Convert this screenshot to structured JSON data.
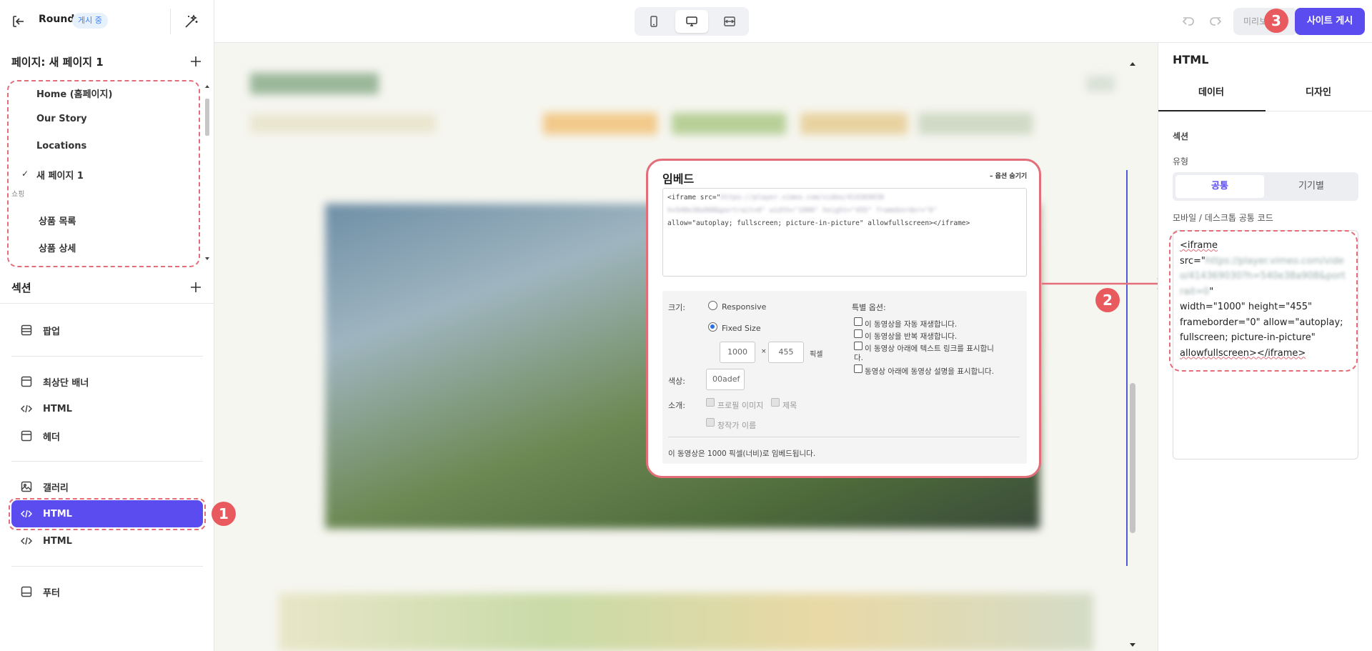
{
  "header": {
    "site_name": "Round",
    "status": "게시 중",
    "preview_label": "미리보기",
    "publish_label": "사이트 게시"
  },
  "pages": {
    "title": "페이지: 새 페이지 1",
    "items": [
      "Home (홈페이지)",
      "Our Story",
      "Locations",
      "새 페이지 1"
    ],
    "group_label": "쇼핑",
    "shop_items": [
      "상품 목록",
      "상품 상세"
    ]
  },
  "sections": {
    "title": "섹션",
    "items": [
      "팝업",
      "최상단 배너",
      "HTML",
      "헤더",
      "갤러리",
      "HTML",
      "HTML",
      "푸터"
    ]
  },
  "embed": {
    "title": "임베드",
    "hide_options": "– 옵션 숨기기",
    "code_line1_prefix": "<iframe src=\"",
    "code_line1_blur": "https://player.vimeo.com/video/414369030",
    "code_line2_blur": "h=540e38a908&portrait=0\" width=\"1000\" height=\"455\" frameborder=\"0\"",
    "code_line3": "allow=\"autoplay; fullscreen; picture-in-picture\" allowfullscreen></iframe>",
    "size_label": "크기:",
    "responsive_label": "Responsive",
    "fixed_label": "Fixed Size",
    "width": "1000",
    "times": "×",
    "height": "455",
    "pixel_label": "픽셀",
    "color_label": "색상:",
    "color_value": "00adef",
    "intro_label": "소개:",
    "profile_label": "프로필 이미지",
    "title_opt_label": "제목",
    "creator_label": "창작가 이름",
    "special_label": "특별 옵션:",
    "opt1": "이 동영상을 자동 재생합니다.",
    "opt2": "이 동영상을 반복 재생합니다.",
    "opt3a": "이 동영상 아래에 텍스트 링크를 표시합니",
    "opt3b": "다.",
    "opt4": "동영상 아래에 동영상 설명을 표시합니다.",
    "footer_text": "이 동영상은 1000 픽셀(너비)로 임베드됩니다."
  },
  "right_panel": {
    "title": "HTML",
    "tabs": [
      "데이터",
      "디자인"
    ],
    "section_label": "섹션",
    "type_label": "유형",
    "type_options": [
      "공통",
      "기기별"
    ],
    "code_label": "모바일 / 데스크톱 공통 코드",
    "code_a": "<iframe",
    "code_b": "src=\"",
    "code_blur": "https://player.vimeo.com/video/414369030?h=540e38a908&portrait=0",
    "code_c": "\"",
    "code_d": "width=\"1000\" height=\"455\"",
    "code_e": "frameborder=\"0\" allow=\"autoplay;",
    "code_f": "fullscreen; picture-in-picture\"",
    "code_g": "allowfullscreen></iframe>"
  },
  "steps": [
    "1",
    "2",
    "3"
  ],
  "colors": {
    "accent": "#5b4cf0",
    "highlight": "#e46d7a",
    "step_badge": "#e85a5e"
  }
}
